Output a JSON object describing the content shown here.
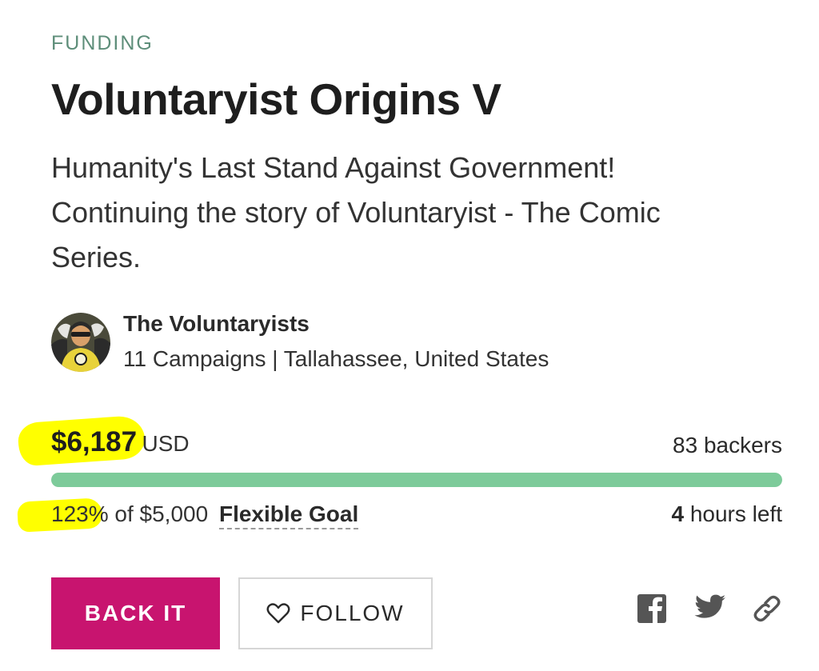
{
  "campaign": {
    "status": "FUNDING",
    "title": "Voluntaryist Origins V",
    "tagline": "Humanity's Last Stand Against Government! Continuing the story of Voluntaryist - The Comic Series."
  },
  "owner": {
    "name": "The Voluntaryists",
    "meta": "11 Campaigns | Tallahassee, United States"
  },
  "funding": {
    "raised_amount": "$6,187",
    "currency": "USD",
    "backers_count": "83",
    "backers_label": "backers",
    "percent": "123%",
    "goal_text": "of $5,000",
    "goal_type": "Flexible Goal",
    "time_value": "4",
    "time_label": "hours left",
    "progress_fraction": 1.0
  },
  "actions": {
    "back_label": "BACK IT",
    "follow_label": "FOLLOW"
  },
  "share": [
    "facebook-icon",
    "twitter-icon",
    "link-icon"
  ],
  "colors": {
    "status_text": "#5e8e7a",
    "progress_fill": "#7dcb9a",
    "back_button": "#c8146f",
    "highlight": "#ffff00",
    "icon": "#555555"
  }
}
